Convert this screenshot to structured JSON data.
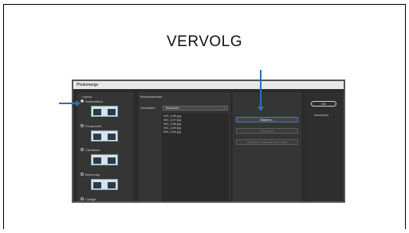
{
  "slide": {
    "title": "VERVOLG"
  },
  "dialog": {
    "title": "Photomerge",
    "layout": {
      "heading": "Layout",
      "options": [
        {
          "label": "Automatisch",
          "selected": true
        },
        {
          "label": "Perspectief",
          "selected": false
        },
        {
          "label": "Cilindrisch",
          "selected": false
        },
        {
          "label": "Bolvormig",
          "selected": false
        },
        {
          "label": "Collage",
          "selected": false
        }
      ]
    },
    "source": {
      "heading": "Bronbestanden",
      "use_label": "Gebruiken:",
      "use_value": "Bestanden",
      "files": [
        "IMG_1046.jpg",
        "IMG_1047.jpg",
        "IMG_1048.jpg",
        "IMG_1049.jpg",
        "IMG_1051.jpg"
      ]
    },
    "buttons": {
      "browse": "Bladeren...",
      "remove": "Verwijderen",
      "add_open": "Geopende bestanden toevoegen",
      "ok": "OK",
      "cancel": "Annuleren"
    }
  },
  "colors": {
    "arrow": "#2f6fb7",
    "dialog_bg": "#2b2b2b"
  }
}
